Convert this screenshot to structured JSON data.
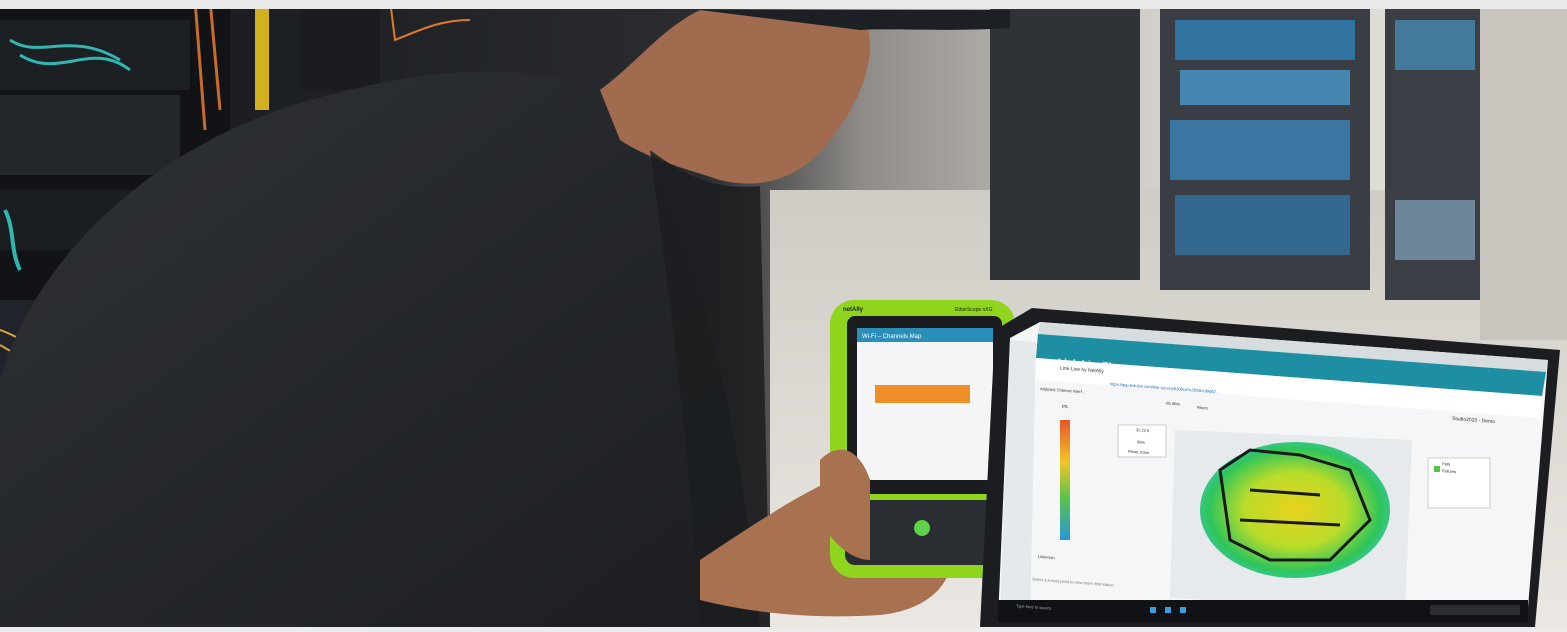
{
  "device": {
    "brand": "netAlly",
    "model": "EtherScope nXG",
    "screen_title": "Wi-Fi – Channels Map"
  },
  "browser": {
    "tab_title": "Link-Live by NetAlly",
    "url": "https://app.link-live.com/#/ar-survey/8206cd7e3f2f4b7d9d02..."
  },
  "app": {
    "brand": "Link-Live™",
    "title": "AirMapper™ Passive: EVT Office BT/BLE",
    "user": "Studio2020 - Demo",
    "filter_label": "Adjacent Channel Interf...",
    "threshold": "-65 dBm",
    "filters_label": "Filters",
    "scale_title": "Int.",
    "scale_bottom": "Unknown",
    "map_size": "32.23 ft",
    "zoom": "86%",
    "reset_zoom": "Reset zoom",
    "legend": [
      "Path",
      "Failures"
    ],
    "status_text": "Select a survey point to view more information",
    "taskbar_search": "Type here to search"
  },
  "colors": {
    "device_green": "#8fd41d",
    "app_teal": "#1e8fa3",
    "heat_green": "#2fc55a",
    "heat_yellow": "#e8d21c",
    "heat_orange": "#f0a02a",
    "heat_cyan": "#40c8d8"
  }
}
